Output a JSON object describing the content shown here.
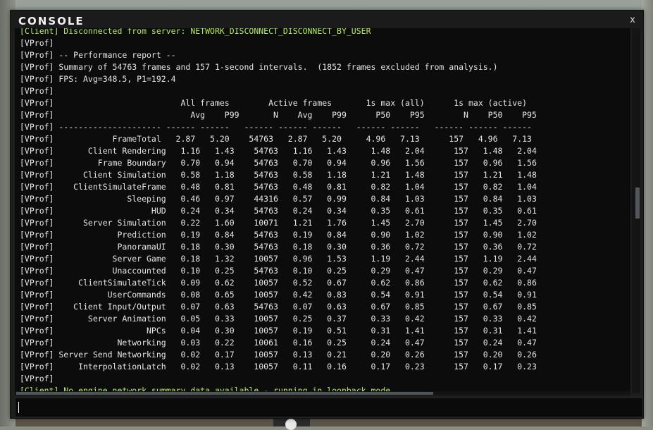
{
  "window": {
    "title": "CONSOLE",
    "close_label": "x"
  },
  "input": {
    "value": "",
    "placeholder": ""
  },
  "colors": {
    "status_text": "#b4f03c",
    "log_text": "#e6e6e6",
    "log_background": "#0c0c0c"
  },
  "log": [
    {
      "kind": "status",
      "text": "[Client] Disconnected from server: NETWORK_DISCONNECT_DISCONNECT_BY_USER"
    },
    {
      "kind": "log",
      "text": "[VProf]"
    },
    {
      "kind": "log",
      "text": "[VProf] -- Performance report --"
    },
    {
      "kind": "log",
      "text": "[VProf] Summary of 54763 frames and 157 1-second intervals.  (1852 frames excluded from analysis.)"
    },
    {
      "kind": "log",
      "text": "[VProf] FPS: Avg=348.5, P1=192.4"
    },
    {
      "kind": "log",
      "text": "[VProf]"
    },
    {
      "kind": "log",
      "text": "[VProf]                          All frames        Active frames       1s max (all)      1s max (active)"
    },
    {
      "kind": "log",
      "text": "[VProf]                            Avg    P99       N    Avg    P99      P50    P95        N    P50    P95"
    },
    {
      "kind": "log",
      "text": "[VProf] --------------------- ------ ------   ------ ------ ------   ------ ------   ------ ------ ------"
    },
    {
      "kind": "log",
      "text": "[VProf]            FrameTotal   2.87   5.20    54763   2.87   5.20     4.96   7.13      157   4.96   7.13"
    },
    {
      "kind": "log",
      "text": "[VProf]       Client Rendering   1.16   1.43    54763   1.16   1.43     1.48   2.04      157   1.48   2.04"
    },
    {
      "kind": "log",
      "text": "[VProf]         Frame Boundary   0.70   0.94    54763   0.70   0.94     0.96   1.56      157   0.96   1.56"
    },
    {
      "kind": "log",
      "text": "[VProf]      Client Simulation   0.58   1.18    54763   0.58   1.18     1.21   1.48      157   1.21   1.48"
    },
    {
      "kind": "log",
      "text": "[VProf]    ClientSimulateFrame   0.48   0.81    54763   0.48   0.81     0.82   1.04      157   0.82   1.04"
    },
    {
      "kind": "log",
      "text": "[VProf]               Sleeping   0.46   0.97    44316   0.57   0.99     0.84   1.03      157   0.84   1.03"
    },
    {
      "kind": "log",
      "text": "[VProf]                    HUD   0.24   0.34    54763   0.24   0.34     0.35   0.61      157   0.35   0.61"
    },
    {
      "kind": "log",
      "text": "[VProf]      Server Simulation   0.22   1.60    10071   1.21   1.76     1.45   2.70      157   1.45   2.70"
    },
    {
      "kind": "log",
      "text": "[VProf]             Prediction   0.19   0.84    54763   0.19   0.84     0.90   1.02      157   0.90   1.02"
    },
    {
      "kind": "log",
      "text": "[VProf]             PanoramaUI   0.18   0.30    54763   0.18   0.30     0.36   0.72      157   0.36   0.72"
    },
    {
      "kind": "log",
      "text": "[VProf]            Server Game   0.18   1.32    10057   0.96   1.53     1.19   2.44      157   1.19   2.44"
    },
    {
      "kind": "log",
      "text": "[VProf]            Unaccounted   0.10   0.25    54763   0.10   0.25     0.29   0.47      157   0.29   0.47"
    },
    {
      "kind": "log",
      "text": "[VProf]     ClientSimulateTick   0.09   0.62    10057   0.52   0.67     0.62   0.86      157   0.62   0.86"
    },
    {
      "kind": "log",
      "text": "[VProf]           UserCommands   0.08   0.65    10057   0.42   0.83     0.54   0.91      157   0.54   0.91"
    },
    {
      "kind": "log",
      "text": "[VProf]    Client Input/Output   0.07   0.63    54763   0.07   0.63     0.67   0.85      157   0.67   0.85"
    },
    {
      "kind": "log",
      "text": "[VProf]       Server Animation   0.05   0.33    10057   0.25   0.37     0.33   0.42      157   0.33   0.42"
    },
    {
      "kind": "log",
      "text": "[VProf]                   NPCs   0.04   0.30    10057   0.19   0.51     0.31   1.41      157   0.31   1.41"
    },
    {
      "kind": "log",
      "text": "[VProf]             Networking   0.03   0.22    10061   0.16   0.25     0.24   0.47      157   0.24   0.47"
    },
    {
      "kind": "log",
      "text": "[VProf] Server Send Networking   0.02   0.17    10057   0.13   0.21     0.20   0.26      157   0.20   0.26"
    },
    {
      "kind": "log",
      "text": "[VProf]     InterpolationLatch   0.02   0.13    10057   0.11   0.16     0.17   0.23      157   0.17   0.23"
    },
    {
      "kind": "log",
      "text": "[VProf]"
    },
    {
      "kind": "status",
      "text": "[Client] No engine network summary data available - running in loopback mode"
    }
  ]
}
